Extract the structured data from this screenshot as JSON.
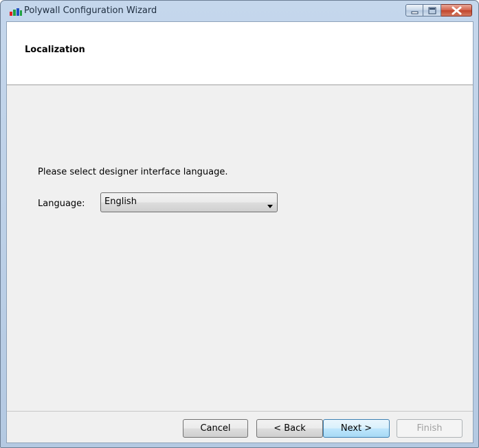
{
  "window": {
    "title": "Polywall Configuration Wizard",
    "app_icon": "polywall-logo-icon",
    "caption_buttons": {
      "minimize_icon": "minimize-icon",
      "maximize_icon": "maximize-icon",
      "close_icon": "close-icon"
    }
  },
  "header": {
    "title": "Localization"
  },
  "main": {
    "prompt": "Please select designer interface language.",
    "language_label": "Language:",
    "language_value": "English",
    "dropdown_icon": "chevron-down-icon"
  },
  "footer": {
    "cancel_label": "Cancel",
    "back_label": "< Back",
    "next_label": "Next >",
    "finish_label": "Finish"
  },
  "colors": {
    "accent_close": "#c74a32",
    "disabled_text": "#a0a0a0"
  }
}
